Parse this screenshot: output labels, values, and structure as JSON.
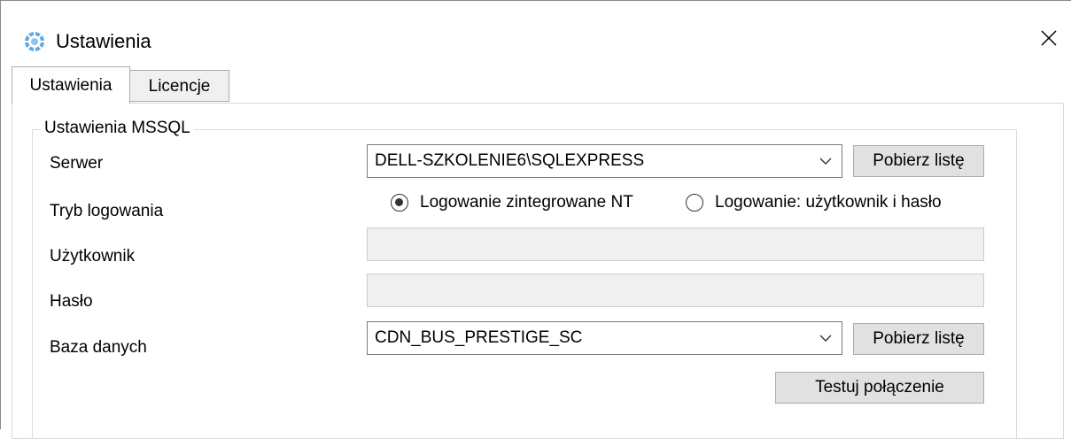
{
  "window": {
    "title": "Ustawienia",
    "close_glyph": "✕"
  },
  "tabs": [
    {
      "label": "Ustawienia",
      "active": true
    },
    {
      "label": "Licencje",
      "active": false
    }
  ],
  "group": {
    "legend": "Ustawienia MSSQL"
  },
  "form": {
    "server": {
      "label": "Serwer",
      "value": "DELL-SZKOLENIE6\\SQLEXPRESS",
      "fetch_button": "Pobierz listę"
    },
    "login_mode": {
      "label": "Tryb logowania",
      "options": [
        {
          "label": "Logowanie zintegrowane NT",
          "selected": true
        },
        {
          "label": "Logowanie: użytkownik i hasło",
          "selected": false
        }
      ]
    },
    "user": {
      "label": "Użytkownik",
      "value": ""
    },
    "password": {
      "label": "Hasło",
      "value": ""
    },
    "database": {
      "label": "Baza danych",
      "value": "CDN_BUS_PRESTIGE_SC",
      "fetch_button": "Pobierz listę"
    },
    "test_button": "Testuj połączenie"
  },
  "icons": {
    "app": "app-settings-icon",
    "close": "close-icon",
    "dropdown": "chevron-down-icon"
  }
}
